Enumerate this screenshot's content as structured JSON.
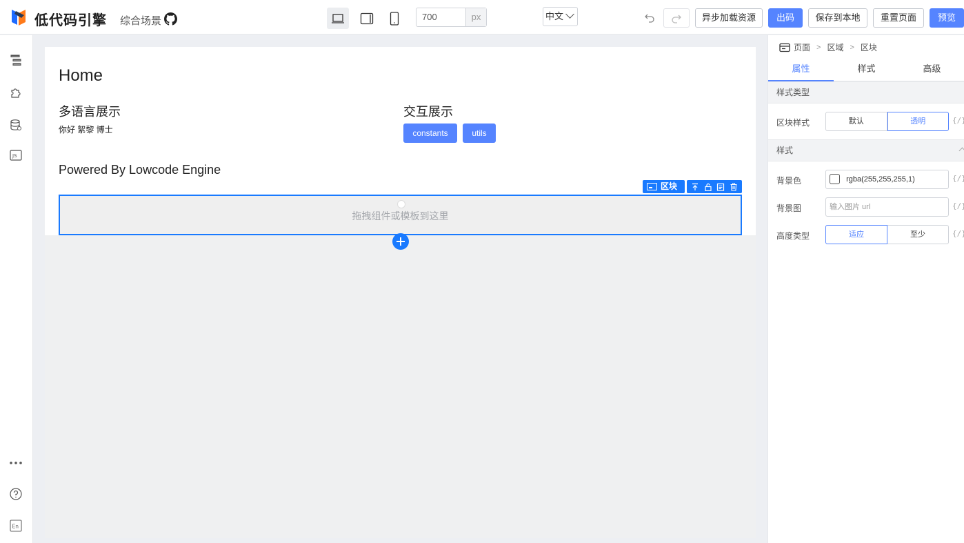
{
  "header": {
    "brand": "低代码引擎",
    "scene": "综合场景",
    "canvas_width": "700",
    "canvas_unit": "px",
    "locale": "中文",
    "buttons": {
      "async_load": "异步加载资源",
      "export": "出码",
      "save_local": "保存到本地",
      "reset": "重置页面",
      "preview": "预览"
    }
  },
  "canvas": {
    "page_title": "Home",
    "i18n_title": "多语言展示",
    "i18n_text": "你好  絮黎 博士",
    "interaction_title": "交互展示",
    "interaction_buttons": [
      "constants",
      "utils"
    ],
    "powered_by": "Powered By Lowcode Engine",
    "block_hint": "拖拽组件或模板到这里",
    "selected_tag": "区块"
  },
  "panel": {
    "breadcrumb": [
      "页面",
      "区域",
      "区块"
    ],
    "tabs": [
      "属性",
      "样式",
      "高级"
    ],
    "groups": {
      "style_type": "样式类型",
      "style": "样式"
    },
    "block_style": {
      "label": "区块样式",
      "options": [
        "默认",
        "透明"
      ],
      "selected": "透明"
    },
    "bg_color": {
      "label": "背景色",
      "value": "rgba(255,255,255,1)"
    },
    "bg_image": {
      "label": "背景图",
      "placeholder": "输入图片 url"
    },
    "height_type": {
      "label": "高度类型",
      "options": [
        "适应",
        "至少"
      ],
      "selected": "适应"
    },
    "fx_label": "{/}"
  },
  "colors": {
    "primary": "#5584ff",
    "selection": "#197aff"
  }
}
